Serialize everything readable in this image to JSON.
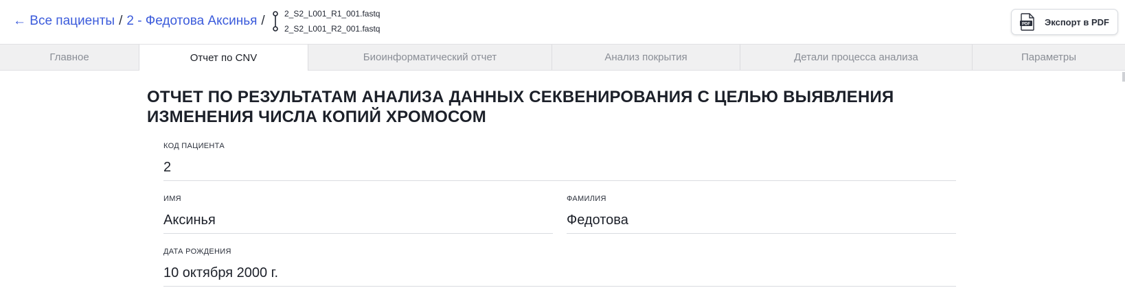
{
  "breadcrumb": {
    "all_patients": "← Все пациенты",
    "separator": "/",
    "patient": "2 - Федотова Аксинья"
  },
  "files": [
    "2_S2_L001_R1_001.fastq",
    "2_S2_L001_R2_001.fastq"
  ],
  "export": {
    "label": "Экспорт в PDF",
    "icon": "pdf-file-icon"
  },
  "tabs": [
    {
      "label": "Главное",
      "active": false
    },
    {
      "label": "Отчет по CNV",
      "active": true
    },
    {
      "label": "Биоинформатический отчет",
      "active": false
    },
    {
      "label": "Анализ покрытия",
      "active": false
    },
    {
      "label": "Детали процесса анализа",
      "active": false
    },
    {
      "label": "Параметры",
      "active": false
    }
  ],
  "report": {
    "title": "ОТЧЕТ ПО РЕЗУЛЬТАТАМ АНАЛИЗА ДАННЫХ СЕКВЕНИРОВАНИЯ С ЦЕЛЬЮ ВЫЯВЛЕНИЯ ИЗМЕНЕНИЯ ЧИСЛА КОПИЙ ХРОМОСОМ",
    "fields": {
      "patient_code": {
        "label": "КОД ПАЦИЕНТА",
        "value": "2"
      },
      "first_name": {
        "label": "ИМЯ",
        "value": "Аксинья"
      },
      "last_name": {
        "label": "ФАМИЛИЯ",
        "value": "Федотова"
      },
      "birth_date": {
        "label": "ДАТА РОЖДЕНИЯ",
        "value": "10 октября 2000 г."
      }
    }
  },
  "colors": {
    "link": "#3b5bdb",
    "tab_bar": "#f0f0f1",
    "tab_inactive_text": "#8a8e96"
  }
}
